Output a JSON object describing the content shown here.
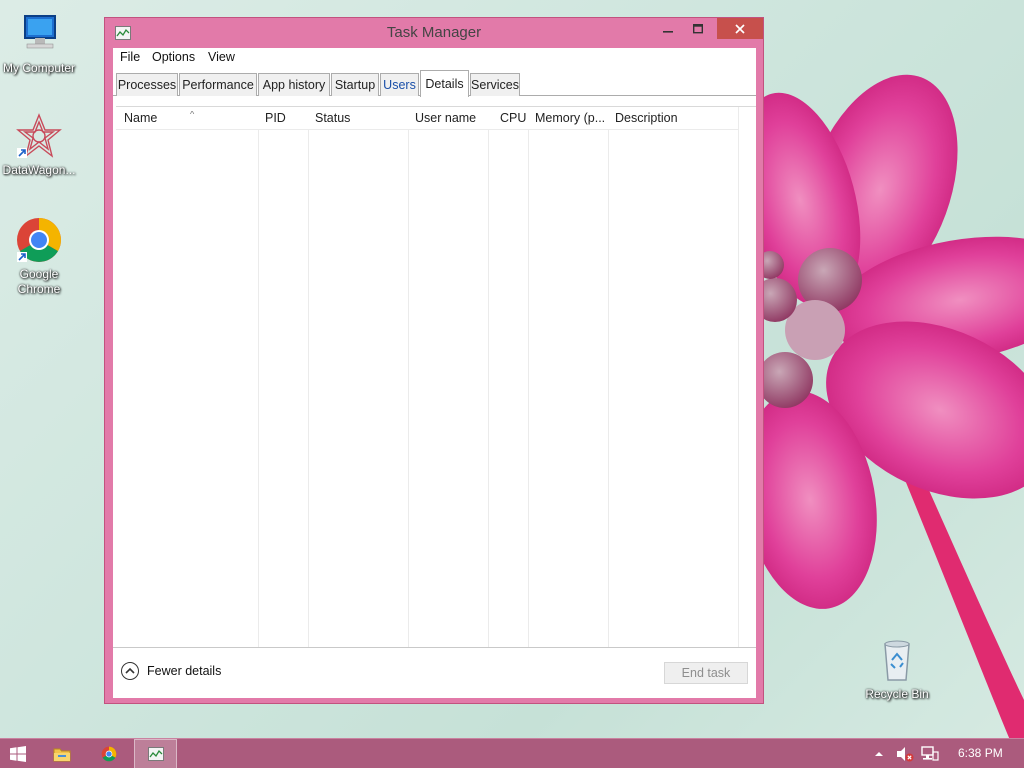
{
  "desktop": {
    "icons": [
      {
        "label": "My Computer"
      },
      {
        "label": "DataWagon..."
      },
      {
        "label": "Google Chrome"
      },
      {
        "label": "Recycle Bin"
      }
    ]
  },
  "window": {
    "title": "Task Manager",
    "menu": [
      "File",
      "Options",
      "View"
    ],
    "tabs": [
      "Processes",
      "Performance",
      "App history",
      "Startup",
      "Users",
      "Details",
      "Services"
    ],
    "active_tab": "Details",
    "columns": [
      "Name",
      "PID",
      "Status",
      "User name",
      "CPU",
      "Memory (p...",
      "Description"
    ],
    "sorted_column": "Name",
    "rows": [],
    "footer": {
      "fewer_details_label": "Fewer details",
      "end_task_label": "End task"
    }
  },
  "taskbar": {
    "pinned": [
      "start",
      "file-explorer",
      "google-chrome",
      "task-manager"
    ],
    "active_app": "task-manager",
    "clock": "6:38 PM"
  },
  "colors": {
    "window_frame": "#e27aa9",
    "close_button": "#c7504c",
    "taskbar": "#ab5b7d"
  }
}
